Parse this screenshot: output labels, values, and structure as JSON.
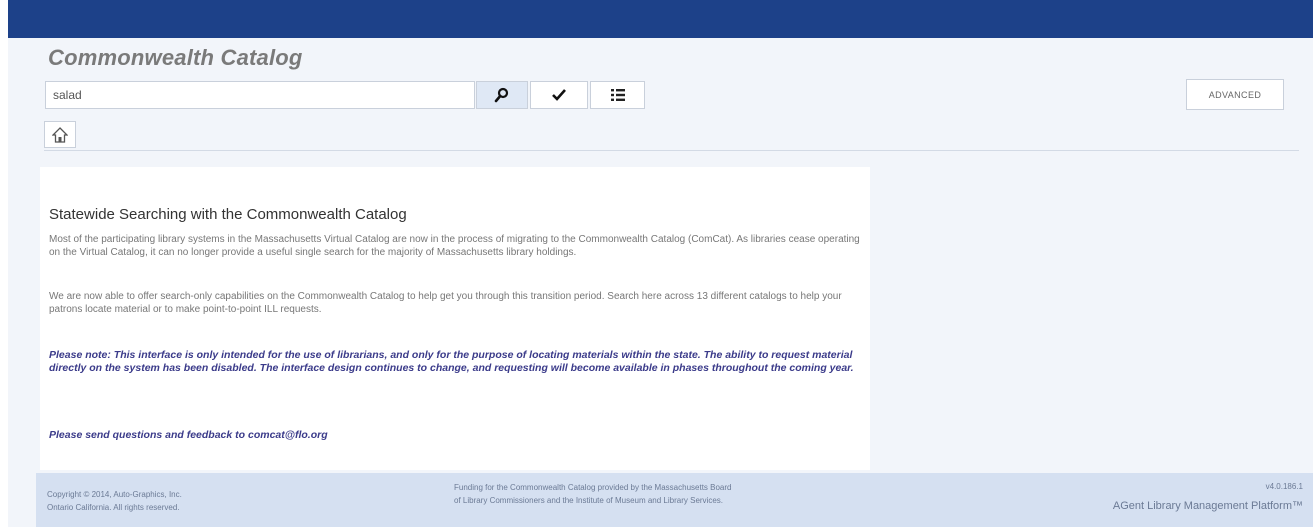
{
  "header": {
    "app_title": "Commonwealth Catalog"
  },
  "search": {
    "value": "salad",
    "advanced_label": "ADVANCED"
  },
  "toolbar": {
    "icons": [
      "search-icon",
      "checkmark-icon",
      "list-icon",
      "home-icon"
    ]
  },
  "content": {
    "heading": "Statewide Searching with the Commonwealth Catalog",
    "paragraph1": "Most of the participating library systems in the Massachusetts Virtual Catalog are now in the process of migrating to the Commonwealth Catalog (ComCat). As libraries cease operating on the Virtual Catalog, it can no longer provide a useful single search for the majority of Massachusetts library holdings.",
    "paragraph2": "We are now able to offer search-only capabilities on the Commonwealth Catalog to help get you through this transition period. Search here across 13 different catalogs to help your patrons locate material or to make point-to-point ILL requests.",
    "note": "Please note: This interface is only intended for the use of librarians, and only for the purpose of locating materials within the state. The ability to request material directly on the system has been disabled. The interface design continues to change, and requesting will become available in phases throughout the coming year.",
    "contact": "Please send questions and feedback to comcat@flo.org"
  },
  "footer": {
    "copyright_line1": "Copyright © 2014, Auto-Graphics, Inc.",
    "copyright_line2": "Ontario California. All rights reserved.",
    "funding_line1": "Funding for the Commonwealth Catalog provided by the Massachusetts Board",
    "funding_line2": "of Library Commissioners and the Institute of Museum and Library Services.",
    "version": "v4.0.186.1",
    "brand": "AGent Library Management Platform™"
  },
  "colors": {
    "top_bar": "#1d4189",
    "footer_bg": "#d5e0f1",
    "note_text": "#3b3b8a"
  }
}
